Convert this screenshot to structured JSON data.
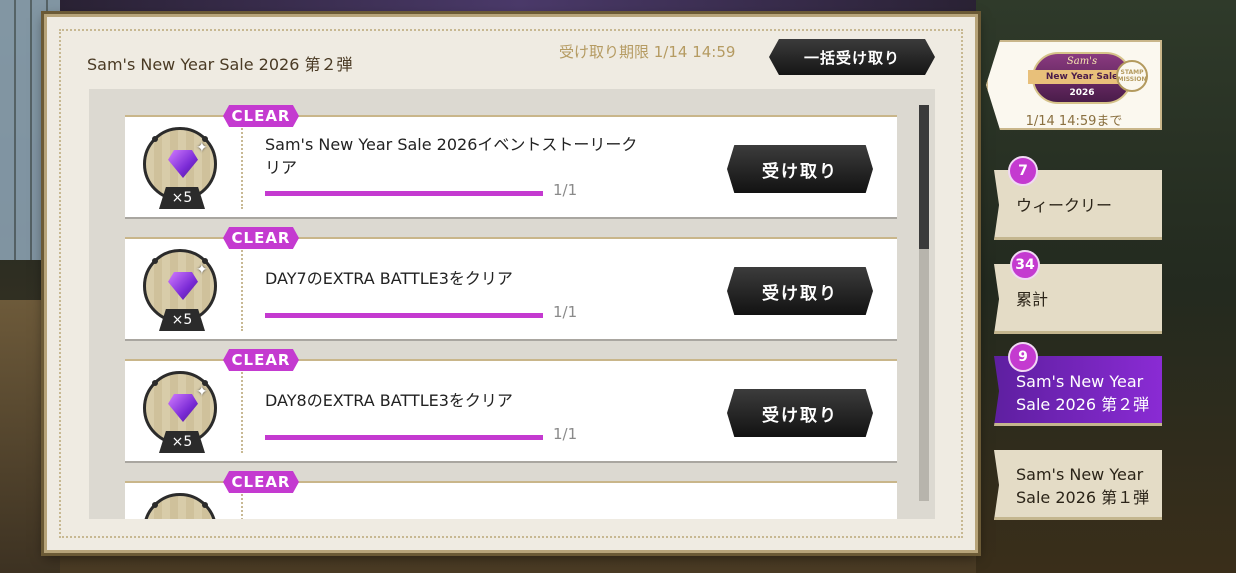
{
  "panel": {
    "title": "Sam's New Year Sale 2026 第２弾",
    "deadline": "受け取り期限 1/14 14:59",
    "bulk_claim_label": "一括受け取り"
  },
  "missions": [
    {
      "status": "CLEAR",
      "reward_icon": "purple-gem-icon",
      "reward_qty": "×5",
      "text": "Sam's New Year Sale 2026イベントストーリークリア",
      "progress": "1/1",
      "progress_fraction": 1.0,
      "claim_label": "受け取り"
    },
    {
      "status": "CLEAR",
      "reward_icon": "purple-gem-icon",
      "reward_qty": "×5",
      "text": "DAY7のEXTRA BATTLE3をクリア",
      "progress": "1/1",
      "progress_fraction": 1.0,
      "claim_label": "受け取り"
    },
    {
      "status": "CLEAR",
      "reward_icon": "purple-gem-icon",
      "reward_qty": "×5",
      "text": "DAY8のEXTRA BATTLE3をクリア",
      "progress": "1/1",
      "progress_fraction": 1.0,
      "claim_label": "受け取り"
    },
    {
      "status": "CLEAR"
    }
  ],
  "event_banner": {
    "logo_brand": "Sam's",
    "logo_title": "New Year Sale",
    "logo_year": "2026",
    "stamp": "STAMP MISSION",
    "deadline": "1/14 14:59まで"
  },
  "tabs": [
    {
      "badge": "7",
      "label": "ウィークリー",
      "active": false
    },
    {
      "badge": "34",
      "label": "累計",
      "active": false
    },
    {
      "badge": "9",
      "label_line1": "Sam's New Year",
      "label_line2": "Sale 2026 第２弾",
      "active": true
    },
    {
      "label_line1": "Sam's New Year",
      "label_line2": "Sale 2026 第１弾",
      "active": false
    }
  ],
  "colors": {
    "accent": "#c43ad0",
    "active_tab": "#7a26c0",
    "button_dark": "#1e1e1e",
    "panel_bg": "#efebe2"
  }
}
